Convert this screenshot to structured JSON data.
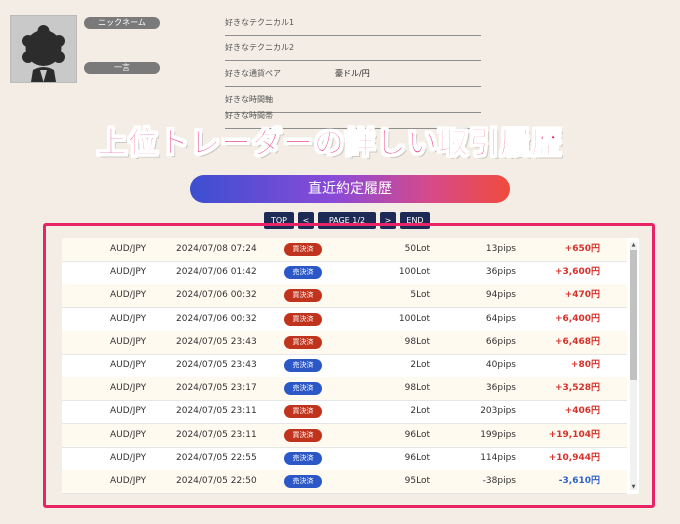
{
  "profile": {
    "nickname_label": "ニックネーム",
    "word_label": "一言",
    "rows": [
      {
        "label": "好きなテクニカル1",
        "value": ""
      },
      {
        "label": "好きなテクニカル2",
        "value": ""
      },
      {
        "label": "好きな通貨ペア",
        "value": "豪ドル/円"
      },
      {
        "label": "好きな時間軸",
        "value": ""
      },
      {
        "label": "好きな時間帯",
        "value": ""
      }
    ]
  },
  "overlay_title": "上位トレーダーの詳しい取引履歴",
  "history_button": "直近約定履歴",
  "pager": {
    "top": "TOP",
    "prev": "<",
    "page": "PAGE 1/2",
    "next": ">",
    "end": "END"
  },
  "colors": {
    "buy": "#c0341d",
    "sell": "#2b57c7",
    "profit_pos": "#d6302a",
    "profit_neg": "#2d63c8",
    "highlight": "#e92466"
  },
  "trades": [
    {
      "pair": "AUD/JPY",
      "datetime": "2024/07/08 07:24",
      "type": "買決済",
      "side": "buy",
      "lot": "50Lot",
      "pips": "13pips",
      "profit": "+650円"
    },
    {
      "pair": "AUD/JPY",
      "datetime": "2024/07/06 01:42",
      "type": "売決済",
      "side": "sell",
      "lot": "100Lot",
      "pips": "36pips",
      "profit": "+3,600円"
    },
    {
      "pair": "AUD/JPY",
      "datetime": "2024/07/06 00:32",
      "type": "買決済",
      "side": "buy",
      "lot": "5Lot",
      "pips": "94pips",
      "profit": "+470円"
    },
    {
      "pair": "AUD/JPY",
      "datetime": "2024/07/06 00:32",
      "type": "買決済",
      "side": "buy",
      "lot": "100Lot",
      "pips": "64pips",
      "profit": "+6,400円"
    },
    {
      "pair": "AUD/JPY",
      "datetime": "2024/07/05 23:43",
      "type": "買決済",
      "side": "buy",
      "lot": "98Lot",
      "pips": "66pips",
      "profit": "+6,468円"
    },
    {
      "pair": "AUD/JPY",
      "datetime": "2024/07/05 23:43",
      "type": "売決済",
      "side": "sell",
      "lot": "2Lot",
      "pips": "40pips",
      "profit": "+80円"
    },
    {
      "pair": "AUD/JPY",
      "datetime": "2024/07/05 23:17",
      "type": "売決済",
      "side": "sell",
      "lot": "98Lot",
      "pips": "36pips",
      "profit": "+3,528円"
    },
    {
      "pair": "AUD/JPY",
      "datetime": "2024/07/05 23:11",
      "type": "買決済",
      "side": "buy",
      "lot": "2Lot",
      "pips": "203pips",
      "profit": "+406円"
    },
    {
      "pair": "AUD/JPY",
      "datetime": "2024/07/05 23:11",
      "type": "買決済",
      "side": "buy",
      "lot": "96Lot",
      "pips": "199pips",
      "profit": "+19,104円"
    },
    {
      "pair": "AUD/JPY",
      "datetime": "2024/07/05 22:55",
      "type": "売決済",
      "side": "sell",
      "lot": "96Lot",
      "pips": "114pips",
      "profit": "+10,944円"
    },
    {
      "pair": "AUD/JPY",
      "datetime": "2024/07/05 22:50",
      "type": "売決済",
      "side": "sell",
      "lot": "95Lot",
      "pips": "-38pips",
      "profit": "-3,610円"
    }
  ]
}
